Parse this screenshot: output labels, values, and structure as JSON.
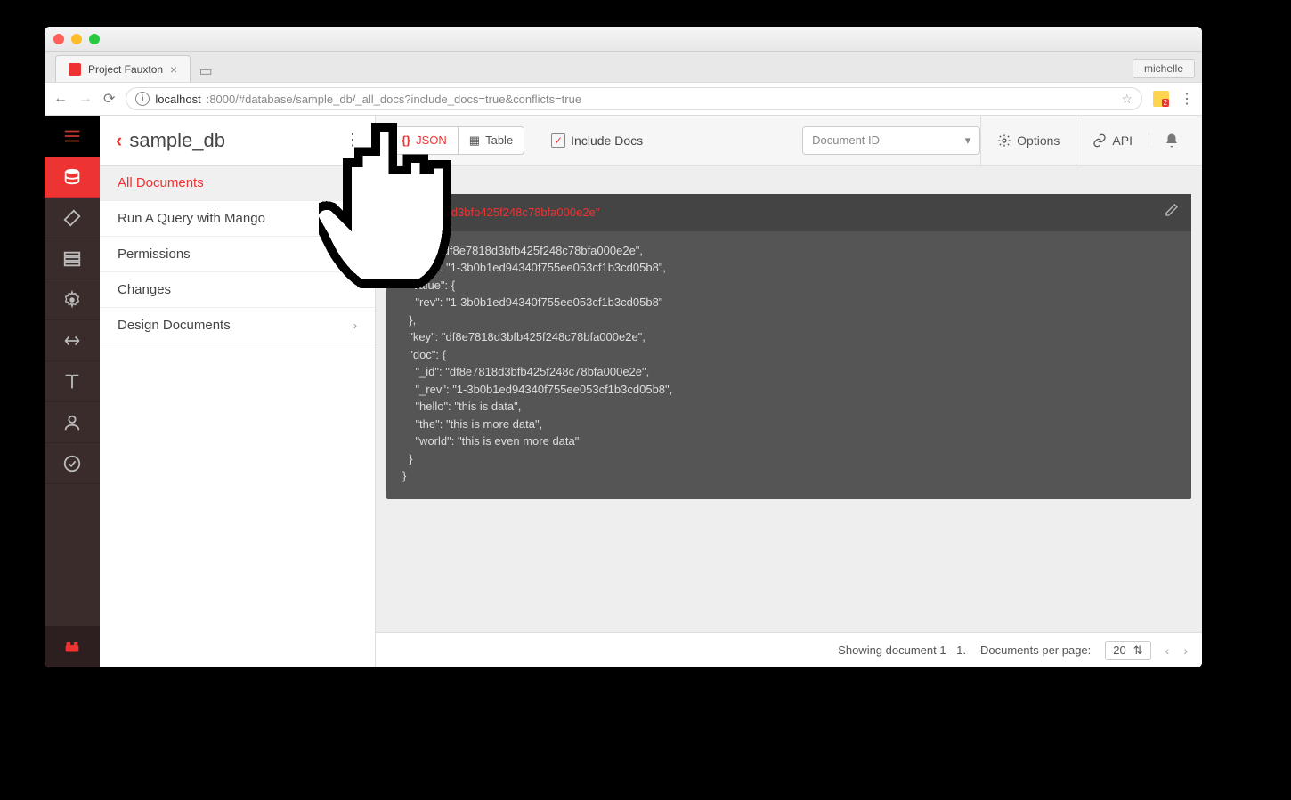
{
  "browser": {
    "tab_title": "Project Fauxton",
    "profile": "michelle",
    "url_host": "localhost",
    "url_path": ":8000/#database/sample_db/_all_docs?include_docs=true&conflicts=true"
  },
  "header": {
    "db_name": "sample_db",
    "json_label": "JSON",
    "table_label": "Table",
    "include_docs_label": "Include Docs",
    "doc_id_placeholder": "Document ID",
    "options_label": "Options",
    "api_label": "API"
  },
  "sidelist": {
    "items": [
      {
        "label": "All Documents",
        "active": true,
        "expandable": false
      },
      {
        "label": "Run A Query with Mango",
        "expandable": false
      },
      {
        "label": "Permissions",
        "expandable": false
      },
      {
        "label": "Changes",
        "expandable": false
      },
      {
        "label": "Design Documents",
        "expandable": true
      }
    ]
  },
  "document": {
    "header_id": "\"df8e7818d3bfb425f248c78bfa000e2e\"",
    "lines": [
      "  \"_id\": \"df8e7818d3bfb425f248c78bfa000e2e\",",
      "  \"_rev\": \"1-3b0b1ed94340f755ee053cf1b3cd05b8\",",
      "  \"value\": {",
      "    \"rev\": \"1-3b0b1ed94340f755ee053cf1b3cd05b8\"",
      "  },",
      "  \"key\": \"df8e7818d3bfb425f248c78bfa000e2e\",",
      "  \"doc\": {",
      "    \"_id\": \"df8e7818d3bfb425f248c78bfa000e2e\",",
      "    \"_rev\": \"1-3b0b1ed94340f755ee053cf1b3cd05b8\",",
      "    \"hello\": \"this is data\",",
      "    \"the\": \"this is more data\",",
      "    \"world\": \"this is even more data\"",
      "  }",
      "}"
    ]
  },
  "footer": {
    "showing": "Showing document 1 - 1.",
    "per_page_label": "Documents per page:",
    "per_page_value": "20"
  }
}
